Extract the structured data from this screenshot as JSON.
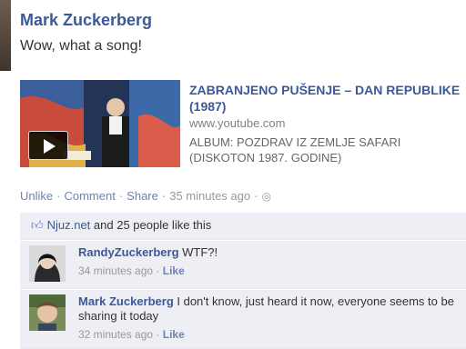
{
  "post": {
    "author": "Mark Zuckerberg",
    "status": "Wow, what a song!"
  },
  "share": {
    "title": "ZABRANJENO PUŠENJE – DAN REPUBLIKE (1987)",
    "url": "www.youtube.com",
    "description": "ALBUM: POZDRAV IZ ZEMLJE SAFARI (DISKOTON 1987. GODINE)"
  },
  "actions": {
    "unlike": "Unlike",
    "comment": "Comment",
    "share": "Share",
    "time": "35 minutes ago"
  },
  "likes": {
    "source": "Njuz.net",
    "rest": " and 25 people like this"
  },
  "comments": [
    {
      "name": "RandyZuckerberg",
      "text": " WTF?!",
      "time": "34 minutes ago",
      "like": "Like"
    },
    {
      "name": "Mark Zuckerberg",
      "text": " I don't know, just heard it now, everyone seems to be sharing it today",
      "time": "32 minutes ago",
      "like": "Like"
    }
  ],
  "icons": {
    "play": "play-icon",
    "globe": "globe-icon",
    "thumbs": "thumbs-up-icon"
  },
  "colors": {
    "link": "#3b5998",
    "action": "#6d84b4",
    "feedback_bg": "#edeff4"
  }
}
